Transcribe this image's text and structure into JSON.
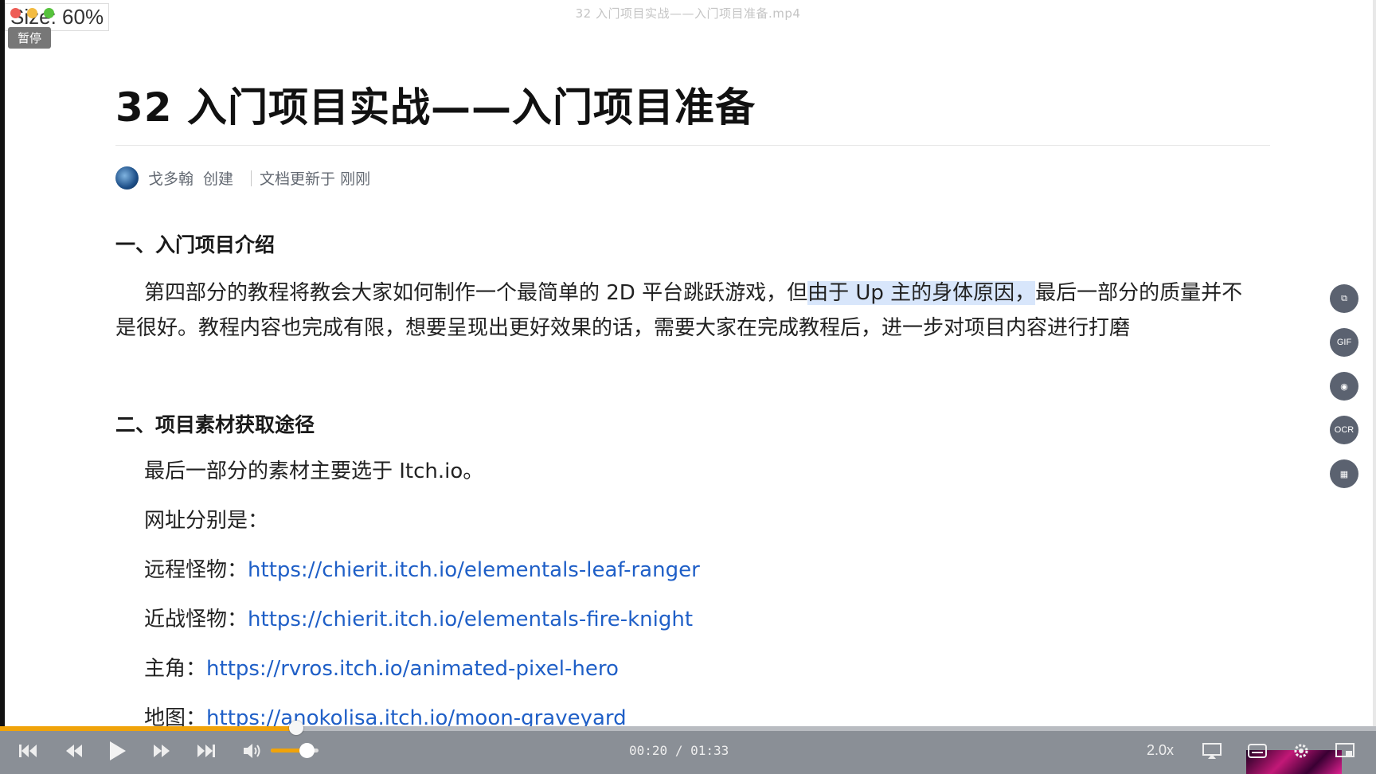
{
  "window": {
    "file_title": "32 入门项目实战——入门项目准备.mp4",
    "size_indicator": "Size: 60%",
    "pause_badge": "暂停"
  },
  "document": {
    "title": "32 入门项目实战——入门项目准备",
    "author": "戈多翰",
    "created": "创建",
    "updated": "文档更新于 刚刚",
    "section1": {
      "heading": "一、入门项目介绍",
      "para_before": "第四部分的教程将教会大家如何制作一个最简单的 2D 平台跳跃游戏，但",
      "para_highlight": "由于 Up 主的身体原因，",
      "para_after": "最后一部分的质量并不是很好。教程内容也完成有限，想要呈现出更好效果的话，需要大家在完成教程后，进一步对项目内容进行打磨"
    },
    "section2": {
      "heading": "二、项目素材获取途径",
      "line1": "最后一部分的素材主要选于 Itch.io。",
      "line2": "网址分别是：",
      "links": [
        {
          "label": "远程怪物：",
          "url": "https://chierit.itch.io/elementals-leaf-ranger"
        },
        {
          "label": "近战怪物：",
          "url": "https://chierit.itch.io/elementals-fire-knight"
        },
        {
          "label": "主角：",
          "url": "https://rvros.itch.io/animated-pixel-hero"
        },
        {
          "label": "地图：",
          "url": "https://anokolisa.itch.io/moon-graveyard"
        }
      ]
    }
  },
  "side_tools": [
    {
      "name": "crop-tool",
      "label": "⧉"
    },
    {
      "name": "gif-tool",
      "label": "GIF"
    },
    {
      "name": "record-tool",
      "label": "◉"
    },
    {
      "name": "ocr-tool",
      "label": "OCR"
    },
    {
      "name": "layout-tool",
      "label": "▦"
    }
  ],
  "player": {
    "current_time": "00:20",
    "total_time": "01:33",
    "time_separator": "/",
    "speed": "2.0x",
    "progress": 0.215,
    "volume": 0.75
  }
}
